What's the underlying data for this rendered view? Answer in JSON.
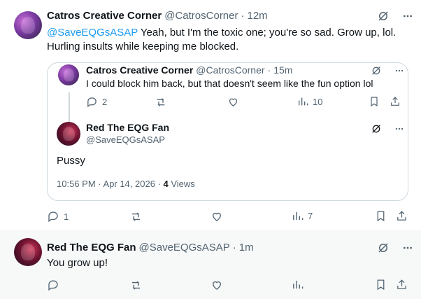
{
  "main_tweet": {
    "name": "Catros Creative Corner",
    "handle": "@CatrosCorner",
    "separator": "·",
    "time": "12m",
    "mention": "@SaveEQGsASAP",
    "text": " Yeah, but I'm the toxic one; you're so sad. Grow up, lol. Hurling insults while keeping me blocked.",
    "actions": {
      "replies": "1",
      "retweets": "",
      "likes": "",
      "views": "7"
    }
  },
  "quote": {
    "parent": {
      "name": "Catros Creative Corner",
      "handle": "@CatrosCorner",
      "separator": "·",
      "time": "15m",
      "text": "I could block him back, but that doesn't seem like the fun option lol",
      "actions": {
        "replies": "2",
        "retweets": "",
        "likes": "",
        "views": "10"
      }
    },
    "child": {
      "name": "Red The EQG Fan",
      "handle": "@SaveEQGsASAP",
      "text": "Pussy",
      "timestamp": "10:56 PM · Apr 14, 2026 · ",
      "views_count": "4",
      "views_label": " Views"
    }
  },
  "reply_tweet": {
    "name": "Red The EQG Fan",
    "handle": "@SaveEQGsASAP",
    "separator": "·",
    "time": "1m",
    "text": "You grow up!"
  },
  "icons": [
    "grok-icon",
    "more-icon",
    "reply-icon",
    "retweet-icon",
    "like-icon",
    "views-icon",
    "bookmark-icon",
    "share-icon"
  ],
  "colors": {
    "link": "#1d9bf0",
    "secondary_text": "#536471",
    "border": "#cfd9de",
    "reply_bg": "#f7f9f9"
  }
}
